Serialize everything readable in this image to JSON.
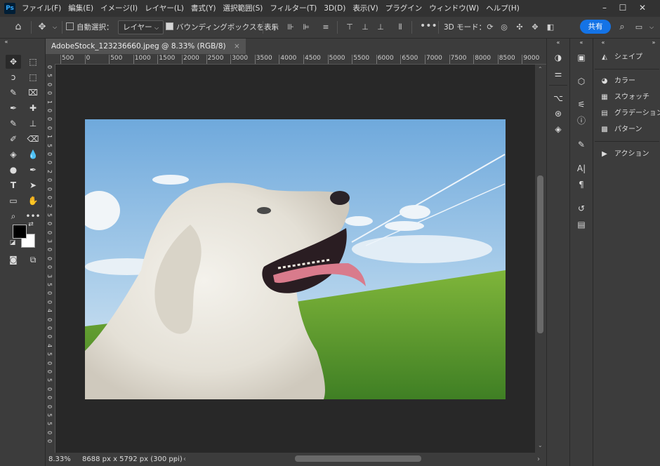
{
  "app": {
    "logo": "Ps"
  },
  "menubar": {
    "items": [
      "ファイル(F)",
      "編集(E)",
      "イメージ(I)",
      "レイヤー(L)",
      "書式(Y)",
      "選択範囲(S)",
      "フィルター(T)",
      "3D(D)",
      "表示(V)",
      "プラグイン",
      "ウィンドウ(W)",
      "ヘルプ(H)"
    ]
  },
  "options": {
    "auto_select_label": "自動選択：",
    "auto_select_value": "レイヤー",
    "bounding_box_label": "バウンディングボックスを表示",
    "mode_3d_label": "3D モード：",
    "share_label": "共有"
  },
  "document": {
    "tab_title": "AdobeStock_123236660.jpeg @ 8.33% (RGB/8)",
    "tab_close": "×",
    "zoom": "8.33%",
    "dimensions": "8688 px x 5792 px (300 ppi)"
  },
  "ruler": {
    "top_ticks": [
      "500",
      "0",
      "500",
      "1000",
      "1500",
      "2000",
      "2500",
      "3000",
      "3500",
      "4000",
      "4500",
      "5000",
      "5500",
      "6000",
      "6500",
      "7000",
      "7500",
      "8000",
      "8500",
      "9000"
    ],
    "left_ticks": [
      "0",
      "5",
      "0",
      "0",
      "1",
      "0",
      "0",
      "0",
      "1",
      "5",
      "0",
      "0",
      "2",
      "0",
      "0",
      "0",
      "2",
      "5",
      "0",
      "0",
      "3",
      "0",
      "0",
      "0",
      "3",
      "5",
      "0",
      "0",
      "4",
      "0",
      "0",
      "0",
      "4",
      "5",
      "0",
      "0",
      "5",
      "0",
      "0",
      "0",
      "5",
      "5",
      "0",
      "0"
    ]
  },
  "panels": {
    "items": [
      {
        "label": "シェイプ",
        "icon": "shapes-icon"
      },
      {
        "label": "カラー",
        "icon": "color-palette-icon"
      },
      {
        "label": "スウォッチ",
        "icon": "swatches-icon"
      },
      {
        "label": "グラデーション",
        "icon": "gradient-icon"
      },
      {
        "label": "パターン",
        "icon": "pattern-icon"
      },
      {
        "label": "アクション",
        "icon": "play-actions-icon"
      }
    ]
  },
  "colors": {
    "accent": "#1473e6",
    "foreground_swatch": "#000000",
    "background_swatch": "#ffffff",
    "canvas_bg": "#282828",
    "ui_bg": "#3c3c3c"
  }
}
